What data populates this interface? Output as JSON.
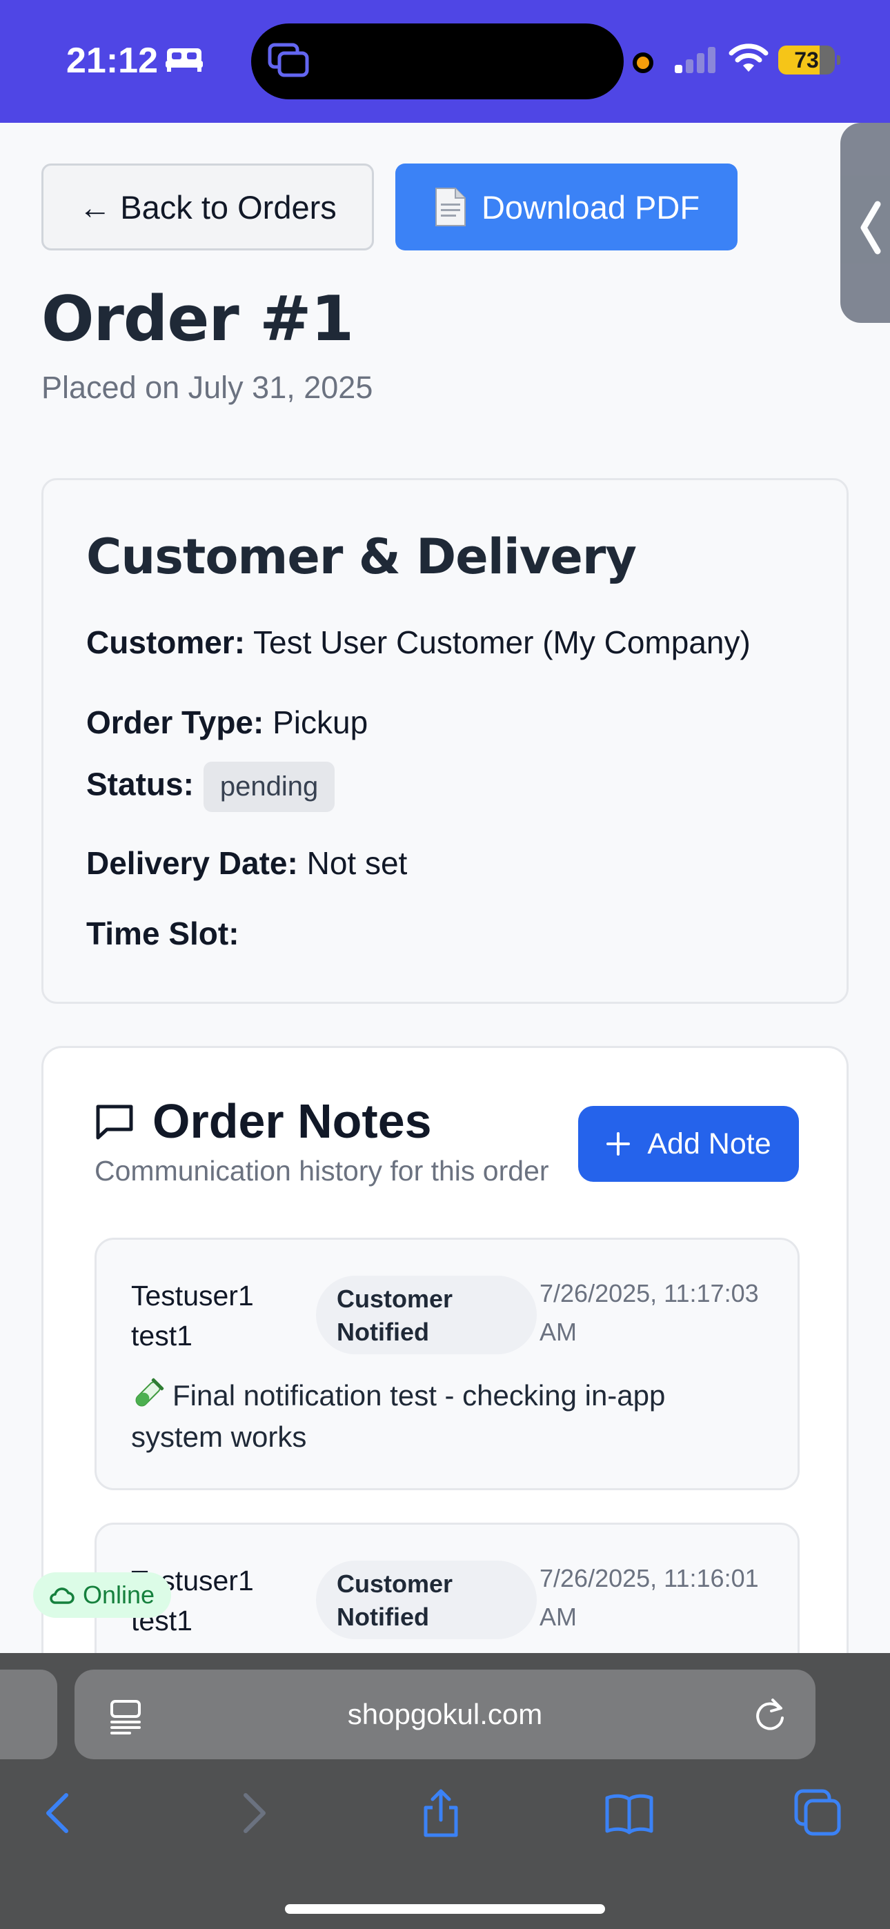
{
  "status_bar": {
    "time": "21:12",
    "battery": "73",
    "battery_level": 0.73,
    "accent": "#4f46e5"
  },
  "actions": {
    "back_label": "← Back to Orders",
    "pdf_label": "Download PDF"
  },
  "order": {
    "title": "Order #1",
    "placed": "Placed on July 31, 2025"
  },
  "customer_card": {
    "title": "Customer & Delivery",
    "customer_label": "Customer:",
    "customer_value": "Test User Customer (My Company)",
    "type_label": "Order Type:",
    "type_value": "Pickup",
    "status_label": "Status:",
    "status_value": "pending",
    "date_label": "Delivery Date:",
    "date_value": "Not set",
    "slot_label": "Time Slot:",
    "slot_value": ""
  },
  "notes": {
    "title": "Order Notes",
    "subtitle": "Communication history for this order",
    "add_label": "Add Note",
    "items": [
      {
        "author_line1": "Testuser1",
        "author_line2": "test1",
        "badge_line1": "Customer",
        "badge_line2": "Notified",
        "time_line1": "7/26/2025, 11:17:03",
        "time_line2": "AM",
        "text": "Final notification test - checking in-app system works",
        "icon": "test-tube-icon"
      },
      {
        "author_line1": "Testuser1",
        "author_line2": "test1",
        "badge_line1": "Customer",
        "badge_line2": "Notified",
        "time_line1": "7/26/2025, 11:16:01",
        "time_line2": "AM",
        "text": ""
      }
    ]
  },
  "connection": {
    "label": "Online"
  },
  "browser": {
    "url": "shopgokul.com"
  },
  "colors": {
    "primary_blue": "#2563eb",
    "pdf_blue": "#3b82f6",
    "online_green": "#15803d"
  }
}
